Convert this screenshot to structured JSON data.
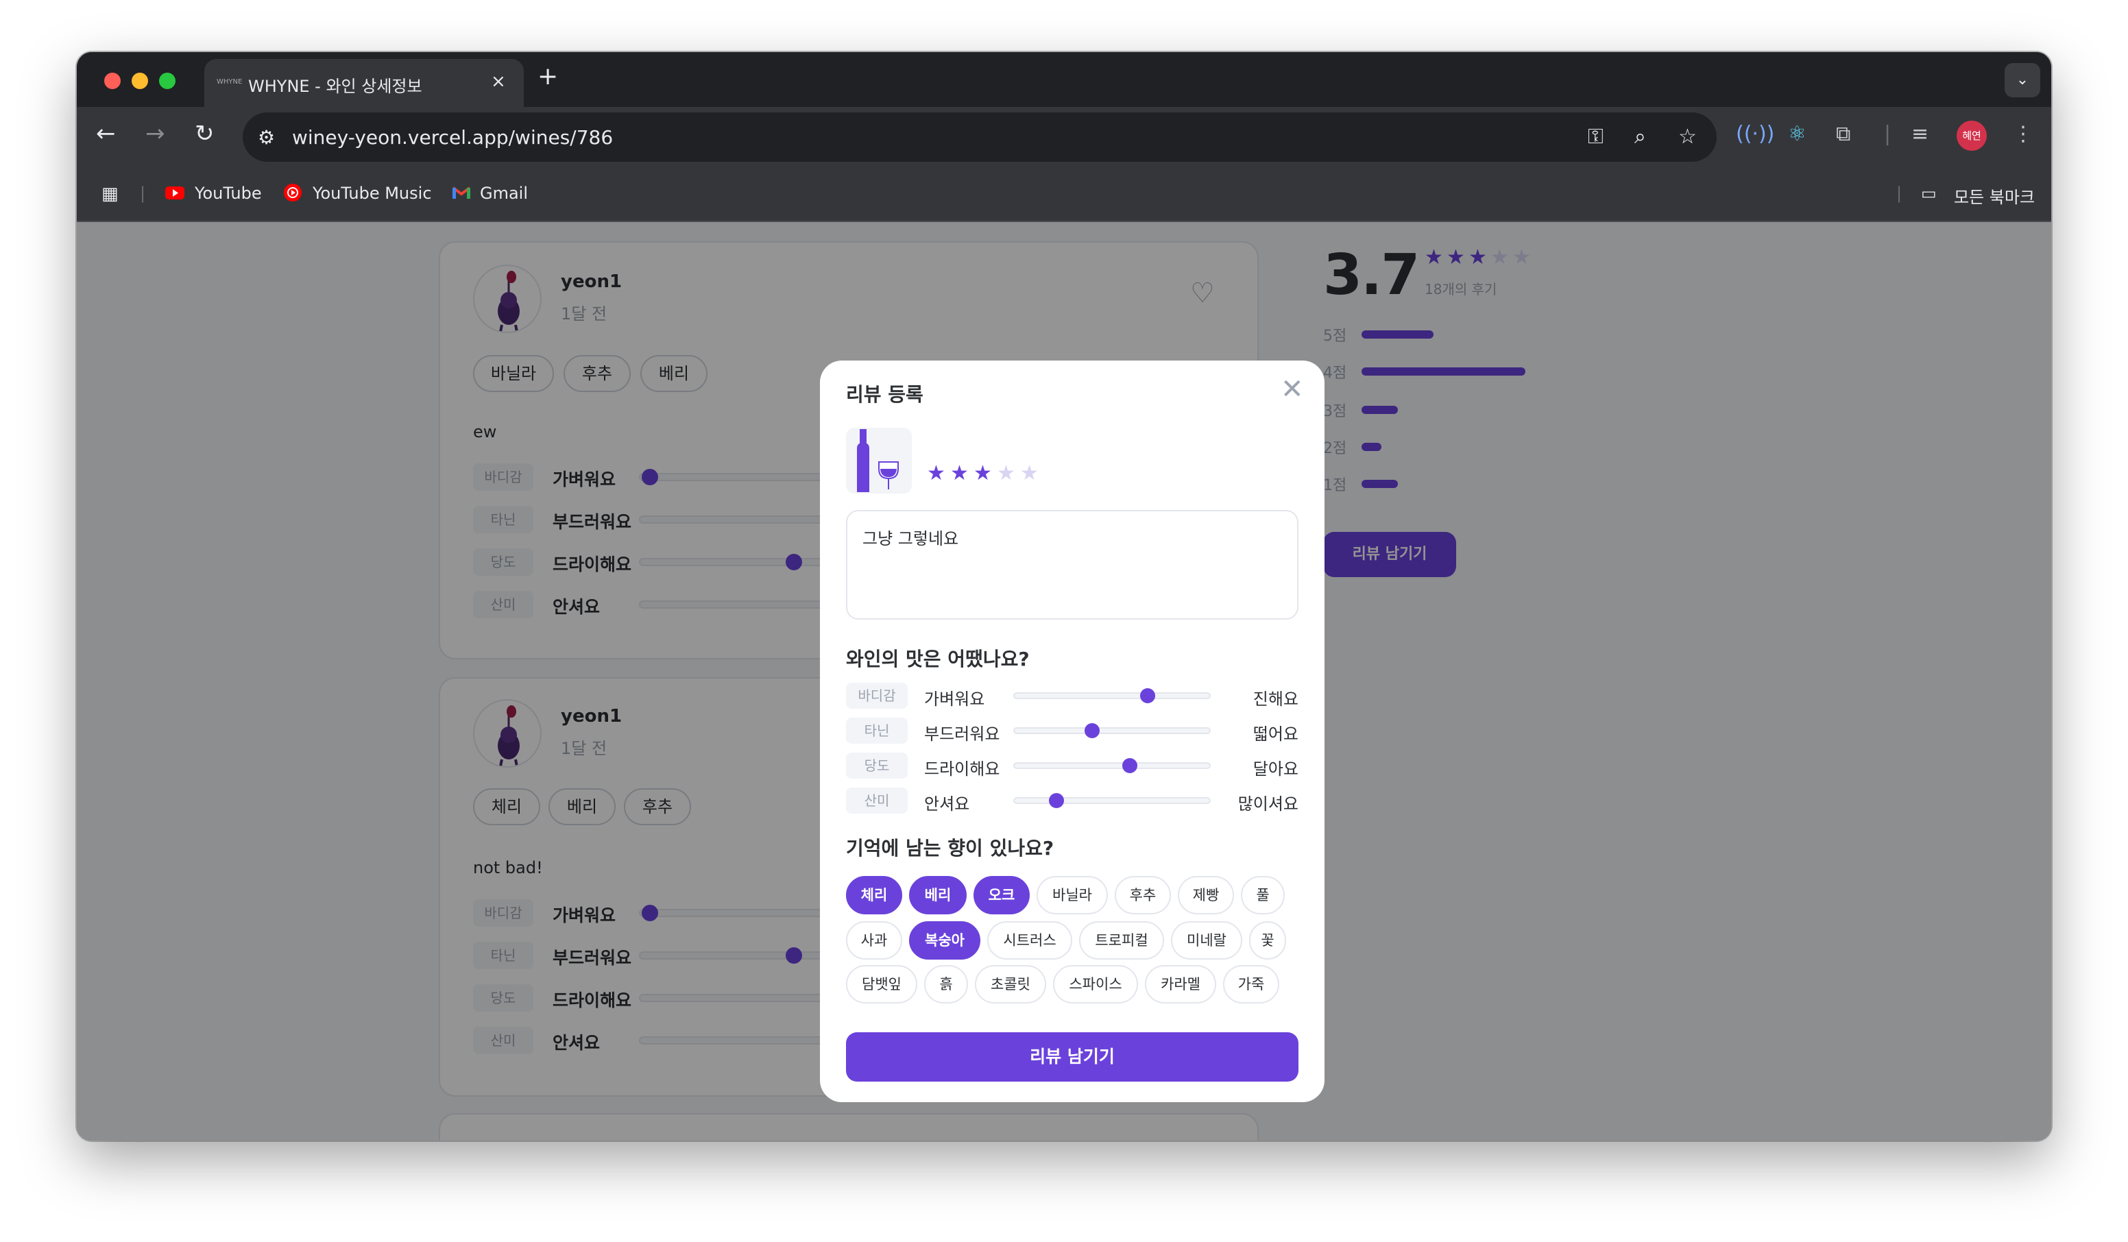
{
  "browser": {
    "tab_title": "WHYNE - 와인 상세정보",
    "tab_favicon_text": "WHYNE",
    "tab_close": "×",
    "new_tab": "+",
    "tab_menu": "⌄",
    "url": "winey-yeon.vercel.app/wines/786",
    "profile_initials": "혜연",
    "bookmarks": [
      {
        "label": "YouTube",
        "icon": "youtube-icon"
      },
      {
        "label": "YouTube Music",
        "icon": "youtube-music-icon"
      },
      {
        "label": "Gmail",
        "icon": "gmail-icon"
      }
    ],
    "all_bookmarks": "모든 북마크"
  },
  "reviews": [
    {
      "user": "yeon1",
      "time": "1달 전",
      "aromas": [
        "바닐라",
        "후추",
        "베리"
      ],
      "text": "ew",
      "taste": [
        {
          "label": "바디감",
          "name": "가벼워요",
          "value": 0.03
        },
        {
          "label": "타닌",
          "name": "부드러워요",
          "value": null
        },
        {
          "label": "당도",
          "name": "드라이해요",
          "value": 0.9
        },
        {
          "label": "산미",
          "name": "안셔요",
          "value": null
        }
      ]
    },
    {
      "user": "yeon1",
      "time": "1달 전",
      "aromas": [
        "체리",
        "베리",
        "후추"
      ],
      "text": "not bad!",
      "taste": [
        {
          "label": "바디감",
          "name": "가벼워요",
          "value": 0.03
        },
        {
          "label": "타닌",
          "name": "부드러워요",
          "value": 0.9
        },
        {
          "label": "당도",
          "name": "드라이해요",
          "value": null
        },
        {
          "label": "산미",
          "name": "안셔요",
          "value": null
        }
      ]
    }
  ],
  "summary": {
    "rating": "3.7",
    "stars": 3,
    "review_count": "18개의 후기",
    "histogram": [
      {
        "label": "5점",
        "fraction": 0.22
      },
      {
        "label": "4점",
        "fraction": 0.5
      },
      {
        "label": "3점",
        "fraction": 0.11
      },
      {
        "label": "2점",
        "fraction": 0.06
      },
      {
        "label": "1점",
        "fraction": 0.11
      }
    ],
    "button": "리뷰 남기기"
  },
  "modal": {
    "title": "리뷰 등록",
    "close": "✕",
    "rating": 3,
    "rating_max": 5,
    "textarea_value": "그냥 그렇네요",
    "taste_heading": "와인의 맛은 어땠나요?",
    "taste": [
      {
        "label": "바디감",
        "left": "가벼워요",
        "right": "진해요",
        "value": 0.68
      },
      {
        "label": "타닌",
        "left": "부드러워요",
        "right": "떫어요",
        "value": 0.4
      },
      {
        "label": "당도",
        "left": "드라이해요",
        "right": "달아요",
        "value": 0.59
      },
      {
        "label": "산미",
        "left": "안셔요",
        "right": "많이셔요",
        "value": 0.22
      }
    ],
    "aroma_heading": "기억에 남는 향이 있나요?",
    "aroma_rows": [
      [
        {
          "label": "체리",
          "selected": true
        },
        {
          "label": "베리",
          "selected": true
        },
        {
          "label": "오크",
          "selected": true
        },
        {
          "label": "바닐라",
          "selected": false
        },
        {
          "label": "후추",
          "selected": false
        },
        {
          "label": "제빵",
          "selected": false
        },
        {
          "label": "풀",
          "selected": false
        }
      ],
      [
        {
          "label": "사과",
          "selected": false
        },
        {
          "label": "복숭아",
          "selected": true
        },
        {
          "label": "시트러스",
          "selected": false
        },
        {
          "label": "트로피컬",
          "selected": false
        },
        {
          "label": "미네랄",
          "selected": false
        },
        {
          "label": "꽃",
          "selected": false
        }
      ],
      [
        {
          "label": "담뱃잎",
          "selected": false
        },
        {
          "label": "흙",
          "selected": false
        },
        {
          "label": "초콜릿",
          "selected": false
        },
        {
          "label": "스파이스",
          "selected": false
        },
        {
          "label": "카라멜",
          "selected": false
        },
        {
          "label": "가죽",
          "selected": false
        }
      ]
    ],
    "submit": "리뷰 남기기"
  },
  "colors": {
    "accent": "#6a42db",
    "star_empty": "#d9d4f2"
  }
}
